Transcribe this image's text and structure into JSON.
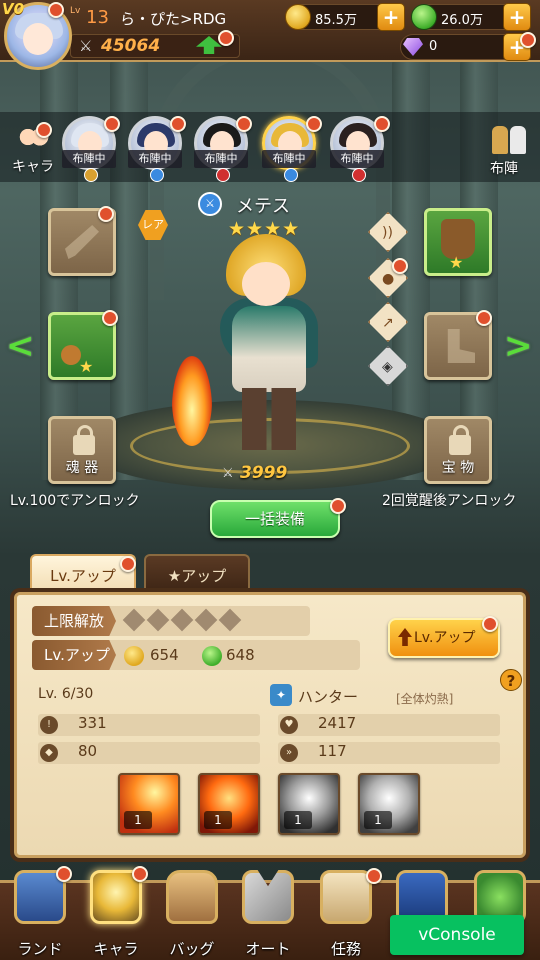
{
  "topbar": {
    "vip": "V0",
    "lv_tag": "Lv",
    "level": "13",
    "player_name": "ら・ぴた>RDG",
    "power": "45064",
    "gold": "85.5万",
    "leaf": "26.0万",
    "gems": "0"
  },
  "hero_row": {
    "chara_label": "キャラ",
    "formation_label": "布陣",
    "deployed_label": "布陣中"
  },
  "hero": {
    "name": "メテス",
    "stars": "★★★★",
    "rarity": "レア",
    "power": "3999"
  },
  "slots": {
    "soul_label": "魂 器",
    "treasure_label": "宝 物",
    "soul_unlock": "Lv.100でアンロック",
    "treasure_unlock": "2回覚醒後アンロック"
  },
  "equip_all_label": "一括装備",
  "tabs": {
    "level_up": "Lv.アップ",
    "star_up": "★アップ"
  },
  "panel": {
    "limit_break_label": "上限解放",
    "level_up_label": "Lv.アップ",
    "cost_gold": "654",
    "cost_leaf": "648",
    "level_up_button": "Lv.アップ",
    "help": "?",
    "level_text": "Lv. 6/30",
    "role": "ハンター",
    "role_tag": "[全体灼熱]",
    "stats": {
      "attack": "331",
      "hp": "2417",
      "defense": "80",
      "speed": "117"
    },
    "skills": [
      {
        "level": "1"
      },
      {
        "level": "1"
      },
      {
        "level": "1"
      },
      {
        "level": "1"
      }
    ]
  },
  "bottom_nav": {
    "land": "ランド",
    "chara": "キャラ",
    "bag": "バッグ",
    "auto": "オート",
    "mission": "任務"
  },
  "vconsole": "vConsole",
  "colors": {
    "accent_orange": "#f09010",
    "accent_green": "#28a83a",
    "badge_red": "#e0502d",
    "panel_bg": "#f6e8c8"
  }
}
